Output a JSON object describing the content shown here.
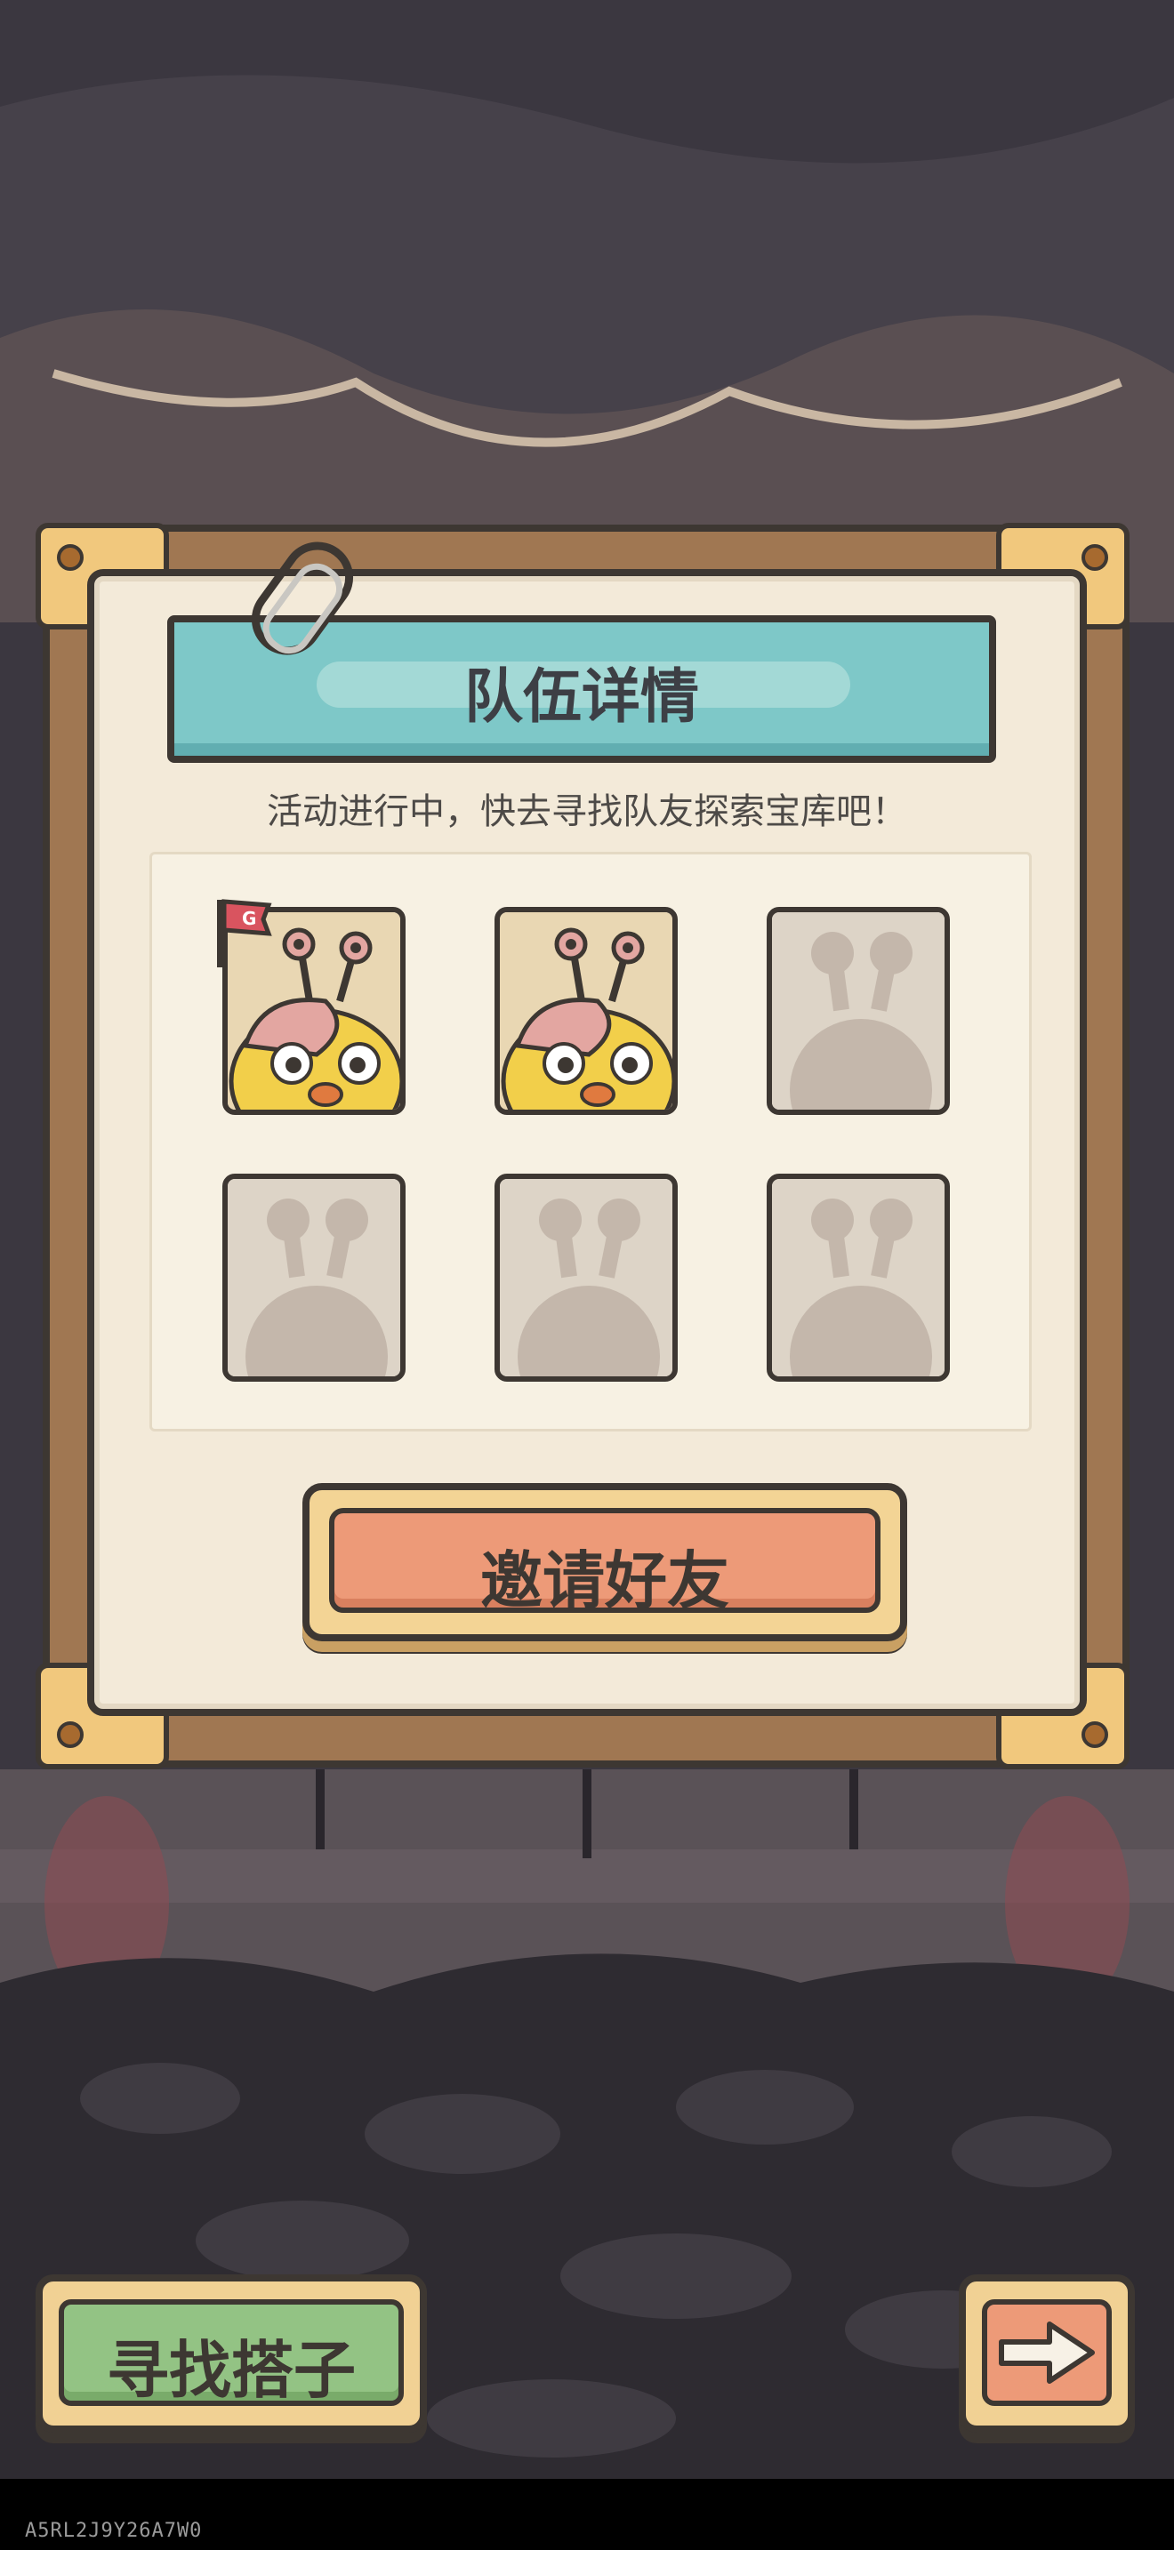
{
  "dialog": {
    "title": "队伍详情",
    "subtitle": "活动进行中，快去寻找队友探索宝库吧！",
    "invite_button_label": "邀请好友"
  },
  "team": {
    "slots": [
      {
        "state": "filled",
        "character": "snail-chick",
        "leader": true
      },
      {
        "state": "filled",
        "character": "snail-chick",
        "leader": false
      },
      {
        "state": "empty"
      },
      {
        "state": "empty"
      },
      {
        "state": "empty"
      },
      {
        "state": "empty"
      }
    ],
    "leader_flag_icon": "flag-icon"
  },
  "footer": {
    "find_partner_label": "寻找搭子",
    "next_icon": "arrow-right-icon"
  },
  "build_id": "A5RL2J9Y26A7W0",
  "colors": {
    "title_banner": "#7ec8c8",
    "invite_button": "#ed9a78",
    "find_button": "#93c384",
    "paper": "#f3ead9",
    "board": "#a07752"
  }
}
